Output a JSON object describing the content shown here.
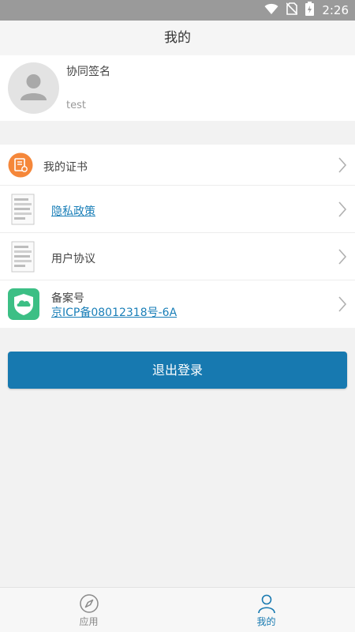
{
  "status_bar": {
    "time": "2:26"
  },
  "header": {
    "title": "我的"
  },
  "profile": {
    "signature_label": "协同签名",
    "username": "test"
  },
  "menu": {
    "items": [
      {
        "label": "我的证书",
        "icon": "certificate-icon"
      },
      {
        "label": "隐私政策",
        "icon": "document-icon"
      },
      {
        "label": "用户协议",
        "icon": "document-icon"
      },
      {
        "label": "备案号",
        "sub": "京ICP备08012318号-6A",
        "icon": "cloud-shield-icon"
      }
    ]
  },
  "logout": {
    "label": "退出登录"
  },
  "tabbar": {
    "tabs": [
      {
        "label": "应用",
        "icon": "compass-icon"
      },
      {
        "label": "我的",
        "icon": "person-icon"
      }
    ]
  },
  "colors": {
    "accent": "#1779b0",
    "link": "#1a7fb8",
    "orange": "#f5873a",
    "green": "#3cbf85"
  }
}
